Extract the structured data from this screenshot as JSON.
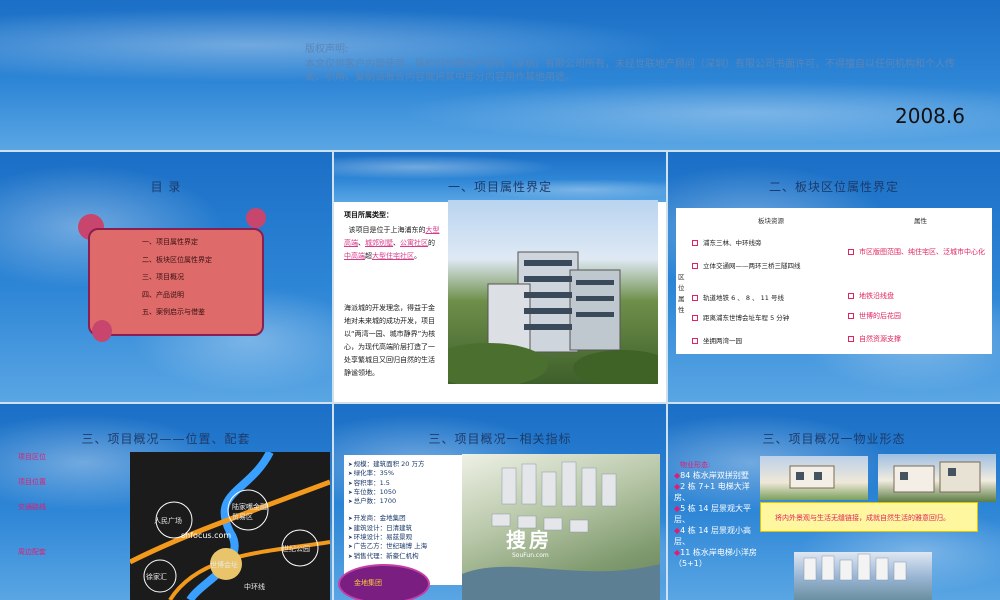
{
  "cover": {
    "copyright_title": "版权声明:",
    "copyright_text": "本文仅供客户内部使用，版权归世联地产顾问（深圳）有限公司所有，未经世联地产顾问（深圳）有限公司书面许可，不得擅自以任何机构和个人传阅、引用、复制该报告内容或将其中部分内容用作其他用途。",
    "date": "2008.6"
  },
  "toc_slide": {
    "title": "目  录",
    "items": [
      "一、项目属性界定",
      "二、板块区位属性界定",
      "三、项目概况",
      "四、产品说明",
      "五、案例启示与借鉴"
    ]
  },
  "attr_slide": {
    "title": "一、项目属性界定",
    "heading": "项目所属类型：",
    "body_prefix": "该项目是位于上海浦东的",
    "highlight_1": "大型高端",
    "body_mid_1": "、",
    "highlight_2": "城郊别墅",
    "body_mid_2": "、",
    "highlight_3": "公寓社区",
    "body_mid_3": "的",
    "highlight_4": "中高端",
    "body_mid_4": "超",
    "highlight_5": "大型住宅社区",
    "body_suffix": "。",
    "body2": "海派城的开发理念，得益于金地对未来城的成功开发，项目以“两湾一园、城市静界”为核心，为现代高端阶层打造了一处享繁城且又回归自然的生活静谧领地。"
  },
  "zone_slide": {
    "title": "二、板块区位属性界定",
    "col_resource": "板块资源",
    "col_attr": "属性",
    "side_label": "区位属性",
    "rows": [
      {
        "resource": "浦东三林、中环线旁",
        "attr": ""
      },
      {
        "resource": "立体交通网——两环三桥三隧四线",
        "attr": "市区版图范围、纯住宅区、泛城市中心化"
      },
      {
        "resource": "轨道地铁 6 、 8 、 11 号线",
        "attr": "地铁沿线盘"
      },
      {
        "resource": "距离浦东世博会址车程 5 分钟",
        "attr": "世博的后花园"
      },
      {
        "resource": "坐拥两湾一园",
        "attr": "自然资源支撑"
      }
    ]
  },
  "location_slide": {
    "title": "三、项目概况——位置、配套",
    "list": [
      "项目区位",
      "项目位置",
      "交通路线",
      "周边配套"
    ],
    "map_labels": [
      "人民广场",
      "陆家嘴金融贸易区",
      "世纪公园",
      "世博会址",
      "徐家汇",
      "中环线"
    ],
    "map_url": "shfocus.com"
  },
  "index_slide": {
    "title": "三、项目概况一相关指标",
    "indicators": [
      "规模：建筑面积 20 万方",
      "绿化率：35%",
      "容积率：1.5",
      "车位数：1050",
      "总户数：1700",
      "开发商：金地集团",
      "建筑设计：日清建筑",
      "环境设计：易兹景观",
      "广告乙方：世纪瑞博 上海",
      "销售代理：新豪仁机构"
    ],
    "badge_text": "金地集团",
    "logo_text": "搜房",
    "logo_sub": "SouFun.com"
  },
  "property_slide": {
    "title": "三、项目概况一物业形态",
    "list_head": "物业形态:",
    "items": [
      "84 栋水岸双拼别墅",
      "2 栋 7+1 电梯大洋房、",
      "5 栋 14 层景观大平层、",
      "4 栋 14 层景观小高层、",
      "11 栋水岸电梯小洋房（5+1）"
    ],
    "note": "将内外景观与生活无缝链接，成就自然生活的雅意回归。"
  }
}
